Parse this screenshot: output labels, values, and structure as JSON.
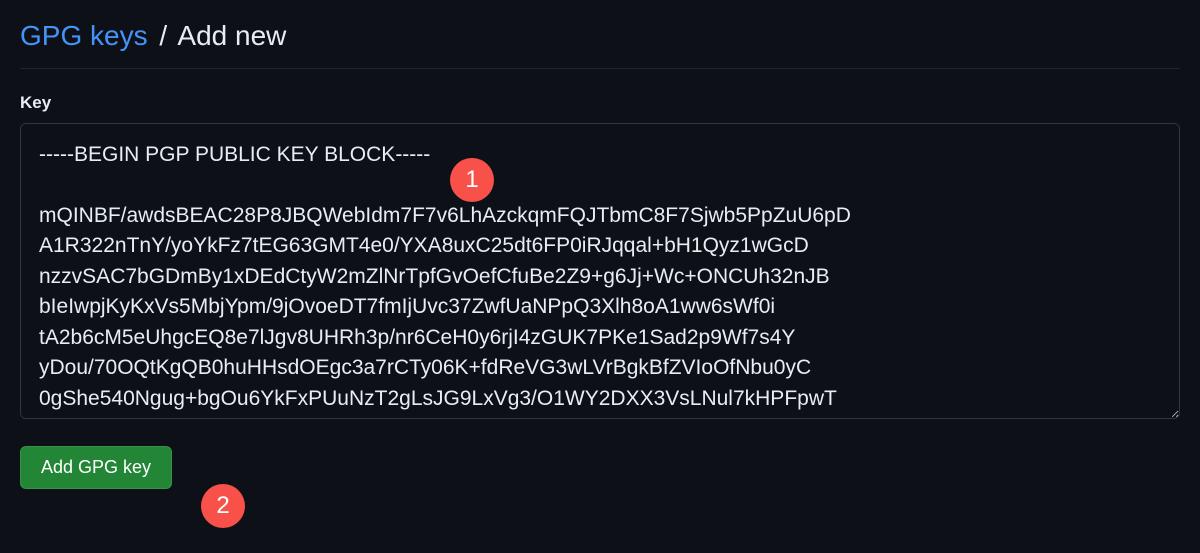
{
  "breadcrumb": {
    "parent": "GPG keys",
    "separator": "/",
    "current": "Add new"
  },
  "form": {
    "field_label": "Key",
    "key_value": "-----BEGIN PGP PUBLIC KEY BLOCK-----\n\nmQINBF/awdsBEAC28P8JBQWebIdm7F7v6LhAzckqmFQJTbmC8F7Sjwb5PpZuU6pD\nA1R322nTnY/yoYkFz7tEG63GMT4e0/YXA8uxC25dt6FP0iRJqqal+bH1Qyz1wGcD\nnzzvSAC7bGDmBy1xDEdCtyW2mZlNrTpfGvOefCfuBe2Z9+g6Jj+Wc+ONCUh32nJB\nbIeIwpjKyKxVs5MbjYpm/9jOvoeDT7fmIjUvc37ZwfUaNPpQ3Xlh8oA1ww6sWf0i\ntA2b6cM5eUhgcEQ8e7lJgv8UHRh3p/nr6CeH0y6rjI4zGUK7PKe1Sad2p9Wf7s4Y\nyDou/70OQtKgQB0huHHsdOEgc3a7rCTy06K+fdReVG3wLVrBgkBfZVIoOfNbu0yC\n0gShe540Ngug+bgOu6YkFxPUuNzT2gLsJG9LxVg3/O1WY2DXX3VsLNul7kHPFpwT",
    "submit_label": "Add GPG key"
  },
  "annotations": {
    "badge1": "1",
    "badge2": "2"
  }
}
